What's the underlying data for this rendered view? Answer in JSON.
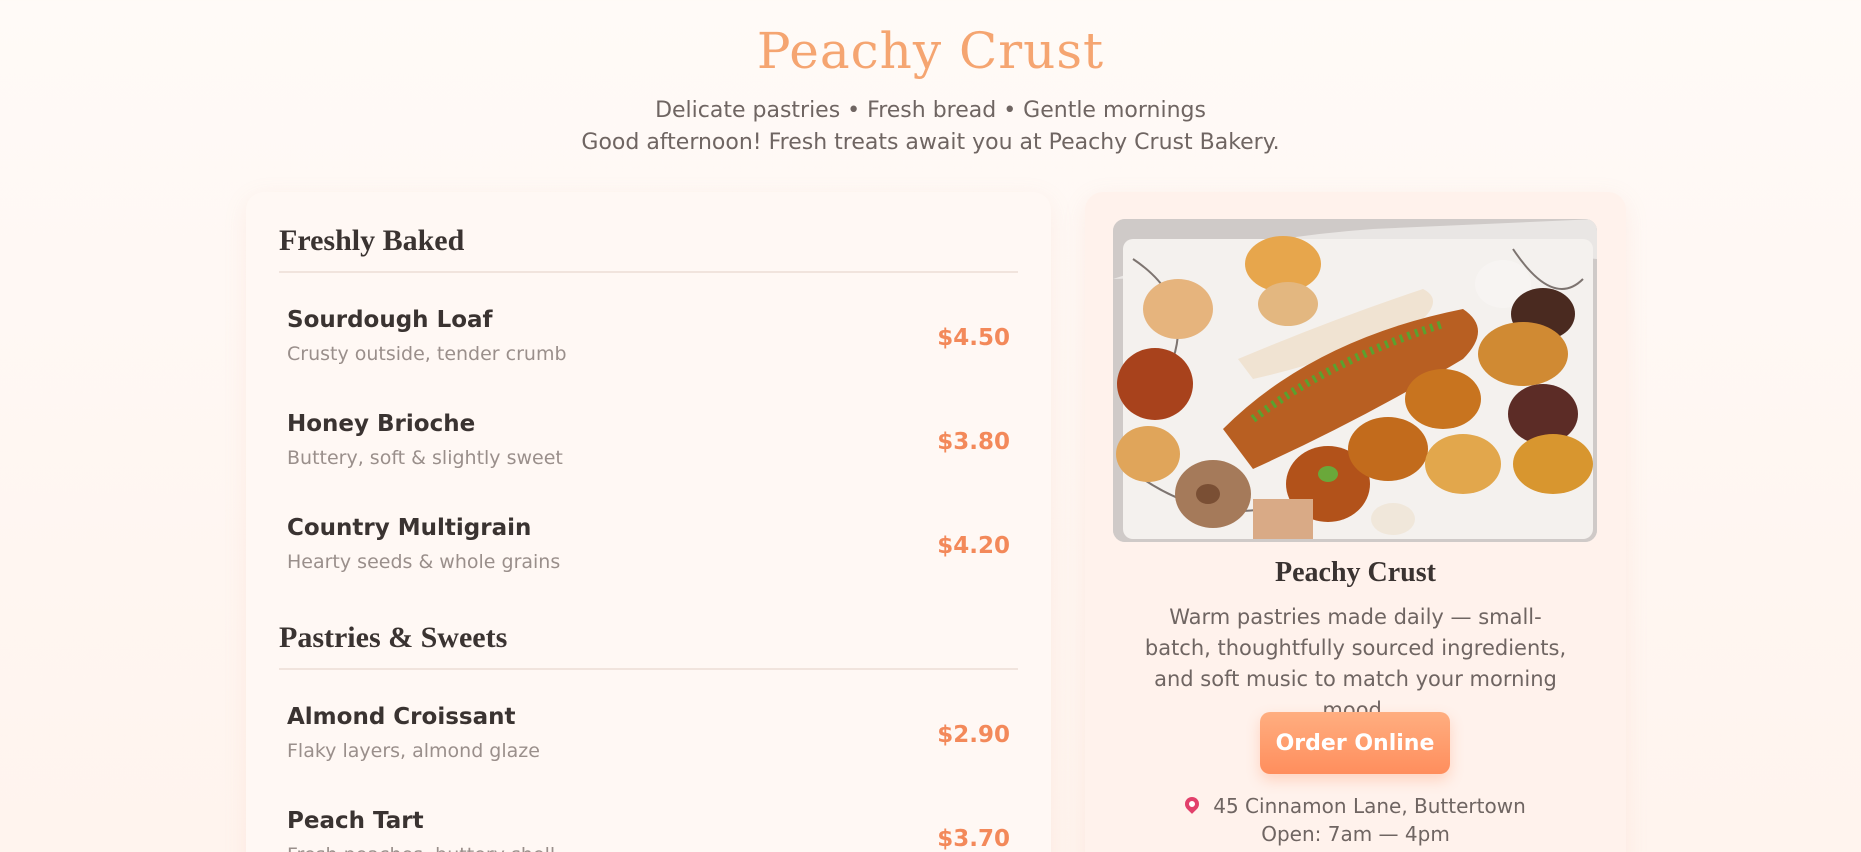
{
  "header": {
    "title": "Peachy Crust",
    "tagline": "Delicate pastries • Fresh bread • Gentle mornings",
    "greeting": "Good afternoon! Fresh treats await you at Peachy Crust Bakery."
  },
  "menu": {
    "sections": [
      {
        "title": "Freshly Baked",
        "items": [
          {
            "name": "Sourdough Loaf",
            "desc": "Crusty outside, tender crumb",
            "price": "$4.50"
          },
          {
            "name": "Honey Brioche",
            "desc": "Buttery, soft & slightly sweet",
            "price": "$3.80"
          },
          {
            "name": "Country Multigrain",
            "desc": "Hearty seeds & whole grains",
            "price": "$4.20"
          }
        ]
      },
      {
        "title": "Pastries & Sweets",
        "items": [
          {
            "name": "Almond Croissant",
            "desc": "Flaky layers, almond glaze",
            "price": "$2.90"
          },
          {
            "name": "Peach Tart",
            "desc": "Fresh peaches, buttery shell",
            "price": "$3.70"
          }
        ]
      }
    ]
  },
  "side": {
    "photo_icon": "pastry-platter-photo",
    "name": "Peachy Crust",
    "description": "Warm pastries made daily — small-batch, thoughtfully sourced ingredients, and soft music to match your morning mood.",
    "order_label": "Order Online",
    "address_icon": "map-pin-icon",
    "address": "45 Cinnamon Lane, Buttertown",
    "hours": "Open: 7am — 4pm"
  },
  "colors": {
    "accent": "#f3895a",
    "title": "#f5a571",
    "pin": "#e2406b"
  }
}
